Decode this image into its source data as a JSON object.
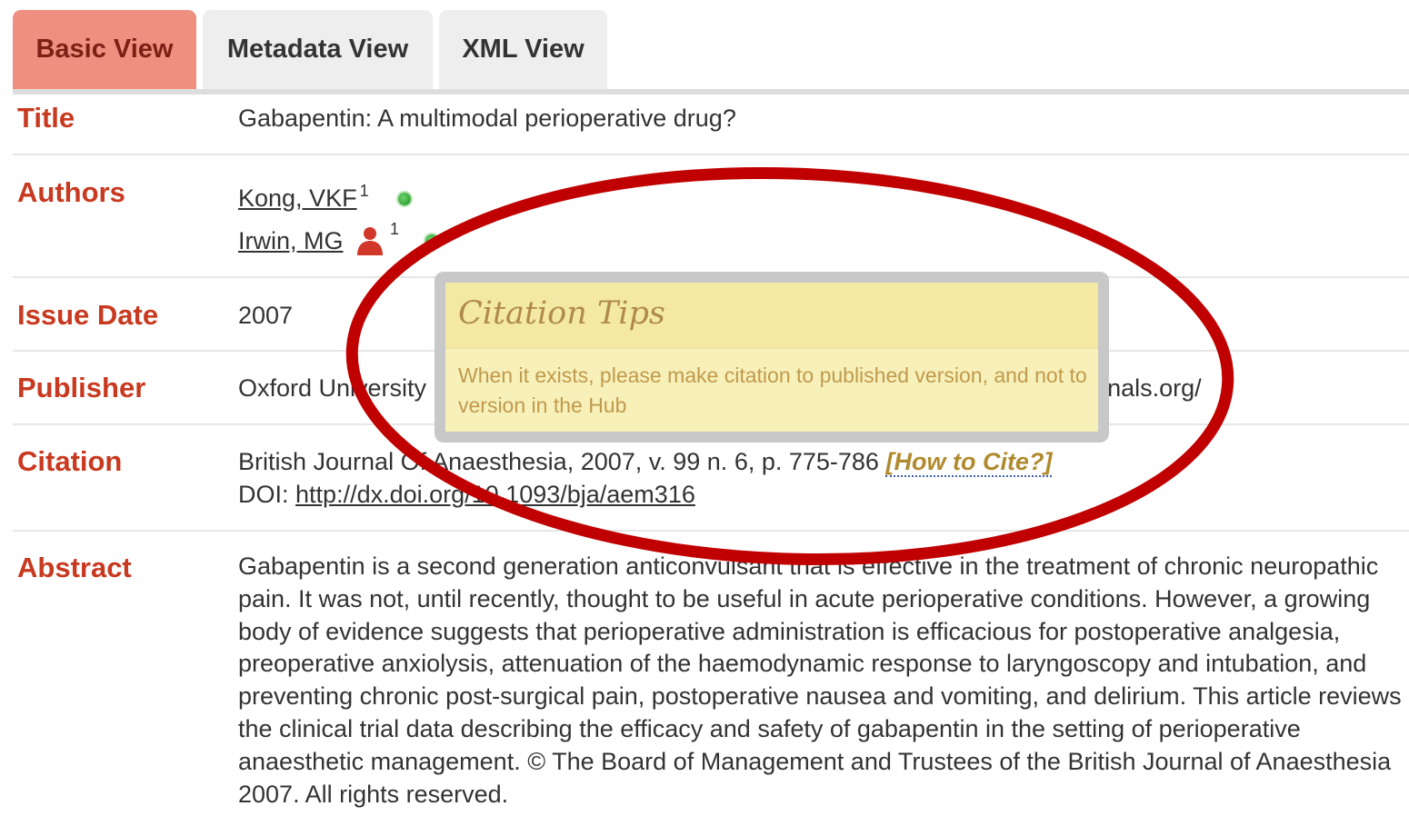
{
  "tabs": [
    {
      "label": "Basic View",
      "active": true
    },
    {
      "label": "Metadata View",
      "active": false
    },
    {
      "label": "XML View",
      "active": false
    }
  ],
  "fields": {
    "title": {
      "label": "Title",
      "value": "Gabapentin: A multimodal perioperative drug?"
    },
    "authors": {
      "label": "Authors",
      "items": [
        {
          "name": "Kong, VKF",
          "sup": "1"
        },
        {
          "name": "Irwin, MG",
          "sup": "1"
        }
      ]
    },
    "issue_date": {
      "label": "Issue Date",
      "value": "2007"
    },
    "publisher": {
      "label": "Publisher",
      "value": "Oxford University Press. The Journal's web site is located at http://bja.oxfordjournals.org/"
    },
    "citation": {
      "label": "Citation",
      "value": "British Journal Of Anaesthesia, 2007, v. 99 n. 6, p. 775-786",
      "how_to_cite": "[How to Cite?]",
      "doi_prefix": "DOI:",
      "doi_url": "http://dx.doi.org/10.1093/bja/aem316"
    },
    "abstract": {
      "label": "Abstract",
      "value": "Gabapentin is a second generation anticonvulsant that is effective in the treatment of chronic neuropathic pain. It was not, until recently, thought to be useful in acute perioperative conditions. However, a growing body of evidence suggests that perioperative administration is efficacious for postoperative analgesia, preoperative anxiolysis, attenuation of the haemodynamic response to laryngoscopy and intubation, and preventing chronic post-surgical pain, postoperative nausea and vomiting, and delirium. This article reviews the clinical trial data describing the efficacy and safety of gabapentin in the setting of perioperative anaesthetic management. © The Board of Management and Trustees of the British Journal of Anaesthesia 2007. All rights reserved."
    }
  },
  "tooltip": {
    "title": "Citation Tips",
    "body": "When it exists, please make citation to published version, and not to version in the Hub"
  },
  "icons": {
    "author_status": "green-dot-icon",
    "corresponding_author": "person-icon"
  },
  "colors": {
    "label": "#c8391f",
    "active_tab": "#ee8f80",
    "highlight": "#c00000",
    "tooltip_bg": "#f7f0b9"
  }
}
